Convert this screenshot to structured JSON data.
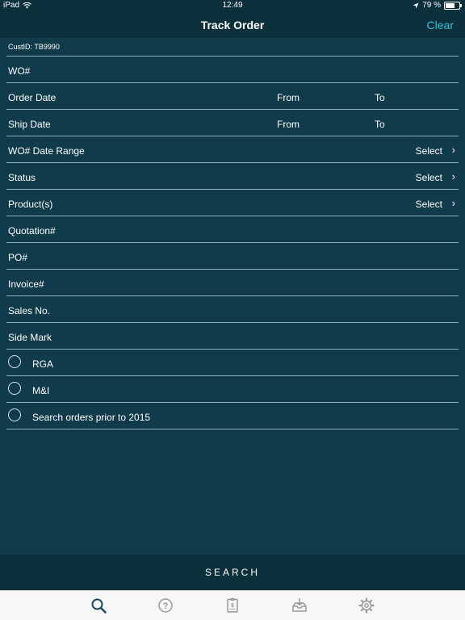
{
  "status_bar": {
    "device": "iPad",
    "time": "12:49",
    "battery": "79 %",
    "battery_level": 0.79
  },
  "nav": {
    "title": "Track Order",
    "clear_label": "Clear"
  },
  "customer": {
    "id_text": "CustID: TB9990"
  },
  "fields": {
    "wo_number": "WO#",
    "order_date": {
      "label": "Order Date",
      "from": "From",
      "to": "To"
    },
    "ship_date": {
      "label": "Ship Date",
      "from": "From",
      "to": "To"
    },
    "wo_date_range": {
      "label": "WO# Date Range",
      "select": "Select"
    },
    "status": {
      "label": "Status",
      "select": "Select"
    },
    "products": {
      "label": "Product(s)",
      "select": "Select"
    },
    "quotation": "Quotation#",
    "po": "PO#",
    "invoice": "Invoice#",
    "sales_no": "Sales No.",
    "side_mark": "Side Mark"
  },
  "options": {
    "rga": "RGA",
    "mi": "M&I",
    "prior_2015": "Search orders prior to 2015"
  },
  "search_button": "SEARCH",
  "tabs": {
    "active_color": "#1a4d5c",
    "inactive_color": "#9a9a9a",
    "items": [
      "search-icon",
      "help-icon",
      "invoice-icon",
      "inbox-download-icon",
      "settings-icon"
    ]
  }
}
